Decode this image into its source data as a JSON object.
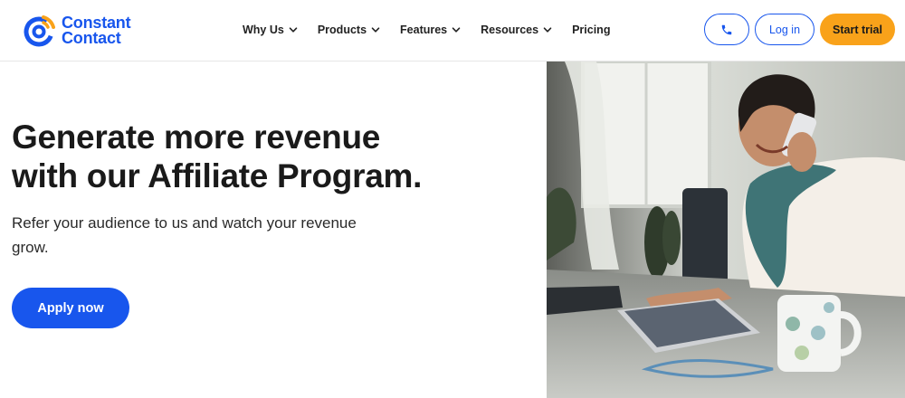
{
  "brand": {
    "name_line1": "Constant",
    "name_line2": "Contact",
    "color": "#1856ed",
    "accent": "#f9a21a"
  },
  "nav": {
    "items": [
      {
        "label": "Why Us",
        "has_dropdown": true
      },
      {
        "label": "Products",
        "has_dropdown": true
      },
      {
        "label": "Features",
        "has_dropdown": true
      },
      {
        "label": "Resources",
        "has_dropdown": true
      },
      {
        "label": "Pricing",
        "has_dropdown": false
      }
    ]
  },
  "header_actions": {
    "phone_icon": "phone-icon",
    "login_label": "Log in",
    "trial_label": "Start trial"
  },
  "hero": {
    "title_line1": "Generate more revenue",
    "title_line2": "with our Affiliate Program.",
    "subtitle_line1": "Refer your audience to us and watch your revenue",
    "subtitle_line2": "grow.",
    "cta_label": "Apply now"
  },
  "image": {
    "subject": "woman-on-phone-using-tablet"
  }
}
